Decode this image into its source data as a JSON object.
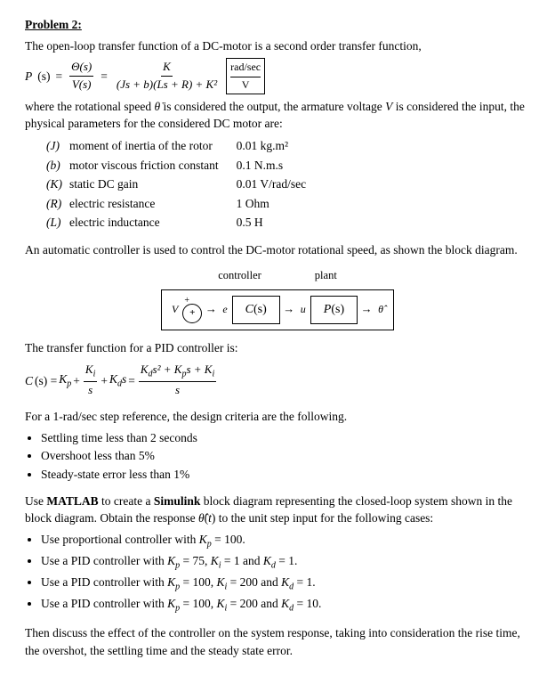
{
  "problem": {
    "title": "Problem 2:",
    "intro": "The open-loop transfer function of a DC-motor is a second order transfer function,",
    "formula_label": "P(s) =",
    "theta_label": "Θ(s)",
    "vs_label": "V(s)",
    "equals": "=",
    "K_num": "K",
    "den": "(Js + b)(Ls + R) + K²",
    "unit_box": "rad/sec",
    "unit_box2": "V",
    "where_text": "where the rotational speed θ̇ is considered the output, the armature voltage V is considered the input, the physical parameters for the considered DC motor are:",
    "params": [
      {
        "symbol": "(J)",
        "desc": "moment of inertia of the rotor",
        "value": "0.01 kg.m²"
      },
      {
        "symbol": "(b)",
        "desc": "motor viscous friction constant",
        "value": "0.1 N.m.s"
      },
      {
        "symbol": "(K)",
        "desc": "static DC gain",
        "value": "0.01 V/rad/sec"
      },
      {
        "symbol": "(R)",
        "desc": "electric resistance",
        "value": "1 Ohm"
      },
      {
        "symbol": "(L)",
        "desc": "electric inductance",
        "value": "0.5 H"
      }
    ],
    "auto_ctrl_text": "An automatic controller is used to control the DC-motor rotational speed, as shown the block diagram.",
    "bd_controller_label": "controller",
    "bd_plant_label": "plant",
    "bd_v_label": "V",
    "bd_e_label": "e",
    "bd_u_label": "u",
    "bd_cs_label": "C(s)",
    "bd_ps_label": "P(s)",
    "bd_theta_label": "θ̂",
    "pid_intro": "The transfer function for a PID controller is:",
    "pid_formula": "C(s) = Kₚ + Kᵢ/s + K_d·s = (K_d·s² + Kₚ·s + Kᵢ) / s",
    "criteria_intro": "For a 1-rad/sec step reference, the design criteria are the following.",
    "criteria": [
      "Settling time less than 2 seconds",
      "Overshoot less than 5%",
      "Steady-state error less than 1%"
    ],
    "matlab_intro1": "Use",
    "matlab_bold": "MATLAB",
    "matlab_intro2": "to create a",
    "simulink_bold": "Simulink",
    "matlab_intro3": "block diagram representing the closed-loop system shown in the block diagram. Obtain the response θ̂(t) to the unit step input for the following cases:",
    "cases": [
      "Use proportional controller with Kₚ = 100.",
      "Use a PID controller with Kₚ = 75, Kᵢ = 1 and K_d = 1.",
      "Use a PID controller with Kₚ = 100, Kᵢ = 200 and K_d = 1.",
      "Use a PID controller with Kₚ = 100, Kᵢ = 200 and K_d = 10."
    ],
    "discuss_text": "Then discuss the effect of the controller on the system response, taking into consideration the rise time, the overshot, the settling time and the steady state error."
  }
}
